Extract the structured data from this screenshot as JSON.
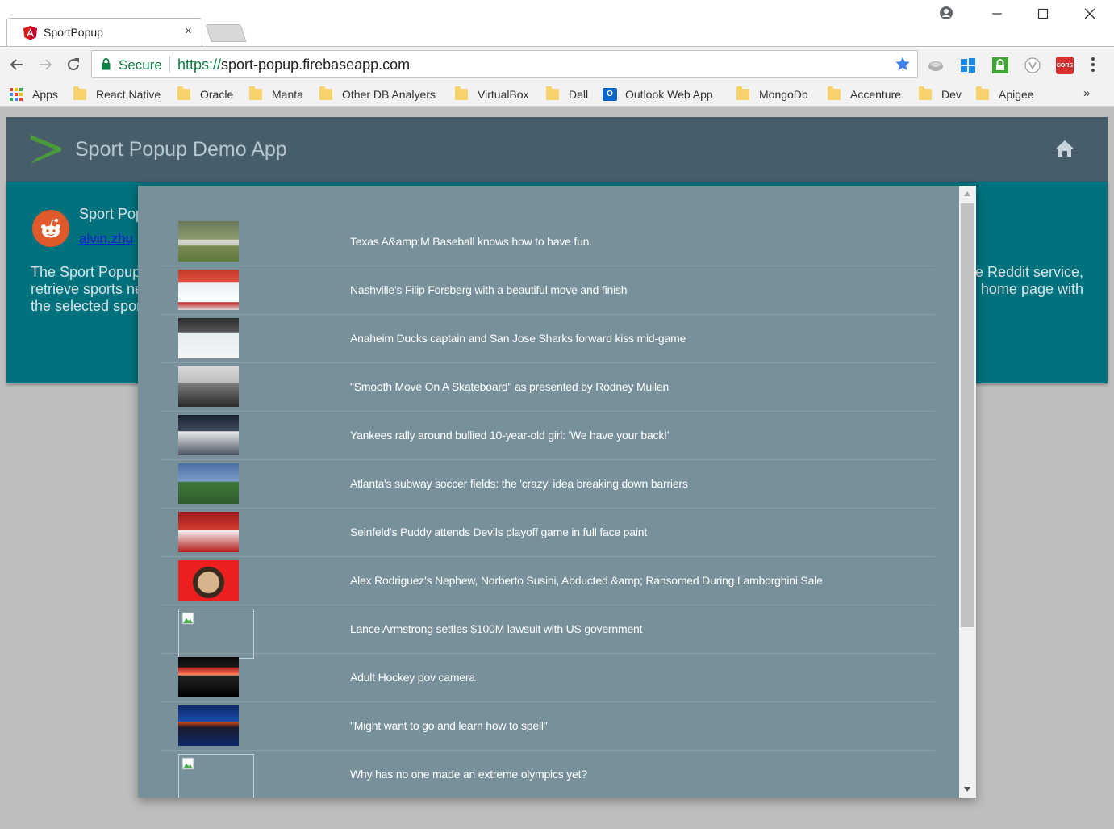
{
  "browser": {
    "tab_title": "SportPopup",
    "close_glyph": "×",
    "secure_label": "Secure",
    "url_scheme": "https://",
    "url_host": "sport-popup.firebaseapp.com",
    "ext_cors_label": "CORS",
    "more_bookmarks": "»",
    "bookmarks": [
      {
        "label": "Apps",
        "icon": "apps-grid-icon"
      },
      {
        "label": "React Native",
        "icon": "folder-icon"
      },
      {
        "label": "Oracle",
        "icon": "folder-icon"
      },
      {
        "label": "Manta",
        "icon": "folder-icon"
      },
      {
        "label": "Other DB Analyers",
        "icon": "folder-icon"
      },
      {
        "label": "VirtualBox",
        "icon": "folder-icon"
      },
      {
        "label": "Dell",
        "icon": "folder-icon"
      },
      {
        "label": "Outlook Web App",
        "icon": "outlook-icon"
      },
      {
        "label": "MongoDb",
        "icon": "folder-icon"
      },
      {
        "label": "Accenture",
        "icon": "folder-icon"
      },
      {
        "label": "Dev",
        "icon": "folder-icon"
      },
      {
        "label": "Apigee",
        "icon": "folder-icon"
      }
    ]
  },
  "app": {
    "title": "Sport Popup Demo App",
    "card": {
      "title_visible": "Sport Pop",
      "link_visible": "alvin.zhu",
      "desc_left": [
        "The Sport Popup",
        "retrieve sports ne",
        "the selected spor"
      ],
      "desc_right": [
        "e Reddit service,",
        "e home page with",
        ""
      ]
    }
  },
  "modal": {
    "posts": [
      {
        "title": "Texas A&amp;M Baseball knows how to have fun.",
        "thumb": "baseball"
      },
      {
        "title": "Nashville's Filip Forsberg with a beautiful move and finish",
        "thumb": "hockey-rink"
      },
      {
        "title": "Anaheim Ducks captain and San Jose Sharks forward kiss mid-game",
        "thumb": "hockey-game"
      },
      {
        "title": "\"Smooth Move On A Skateboard\" as presented by Rodney Mullen",
        "thumb": "skate"
      },
      {
        "title": "Yankees rally around bullied 10-year-old girl: 'We have your back!'",
        "thumb": "yankees"
      },
      {
        "title": "Atlanta's subway soccer fields: the 'crazy' idea breaking down barriers",
        "thumb": "soccer"
      },
      {
        "title": "Seinfeld's Puddy attends Devils playoff game in full face paint",
        "thumb": "devils"
      },
      {
        "title": "Alex Rodriguez's Nephew, Norberto Susini, Abducted &amp; Ransomed During Lamborghini Sale",
        "thumb": "portrait"
      },
      {
        "title": "Lance Armstrong settles $100M lawsuit with US government",
        "thumb": "broken"
      },
      {
        "title": "Adult Hockey pov camera",
        "thumb": "dark"
      },
      {
        "title": "\"Might want to go and learn how to spell\"",
        "thumb": "broadcast"
      },
      {
        "title": "Why has no one made an extreme olympics yet?",
        "thumb": "broken"
      }
    ]
  },
  "colors": {
    "header": "#475e6a",
    "teal_card": "#00727d",
    "modal": "#78909a",
    "secure_green": "#0b8043"
  }
}
